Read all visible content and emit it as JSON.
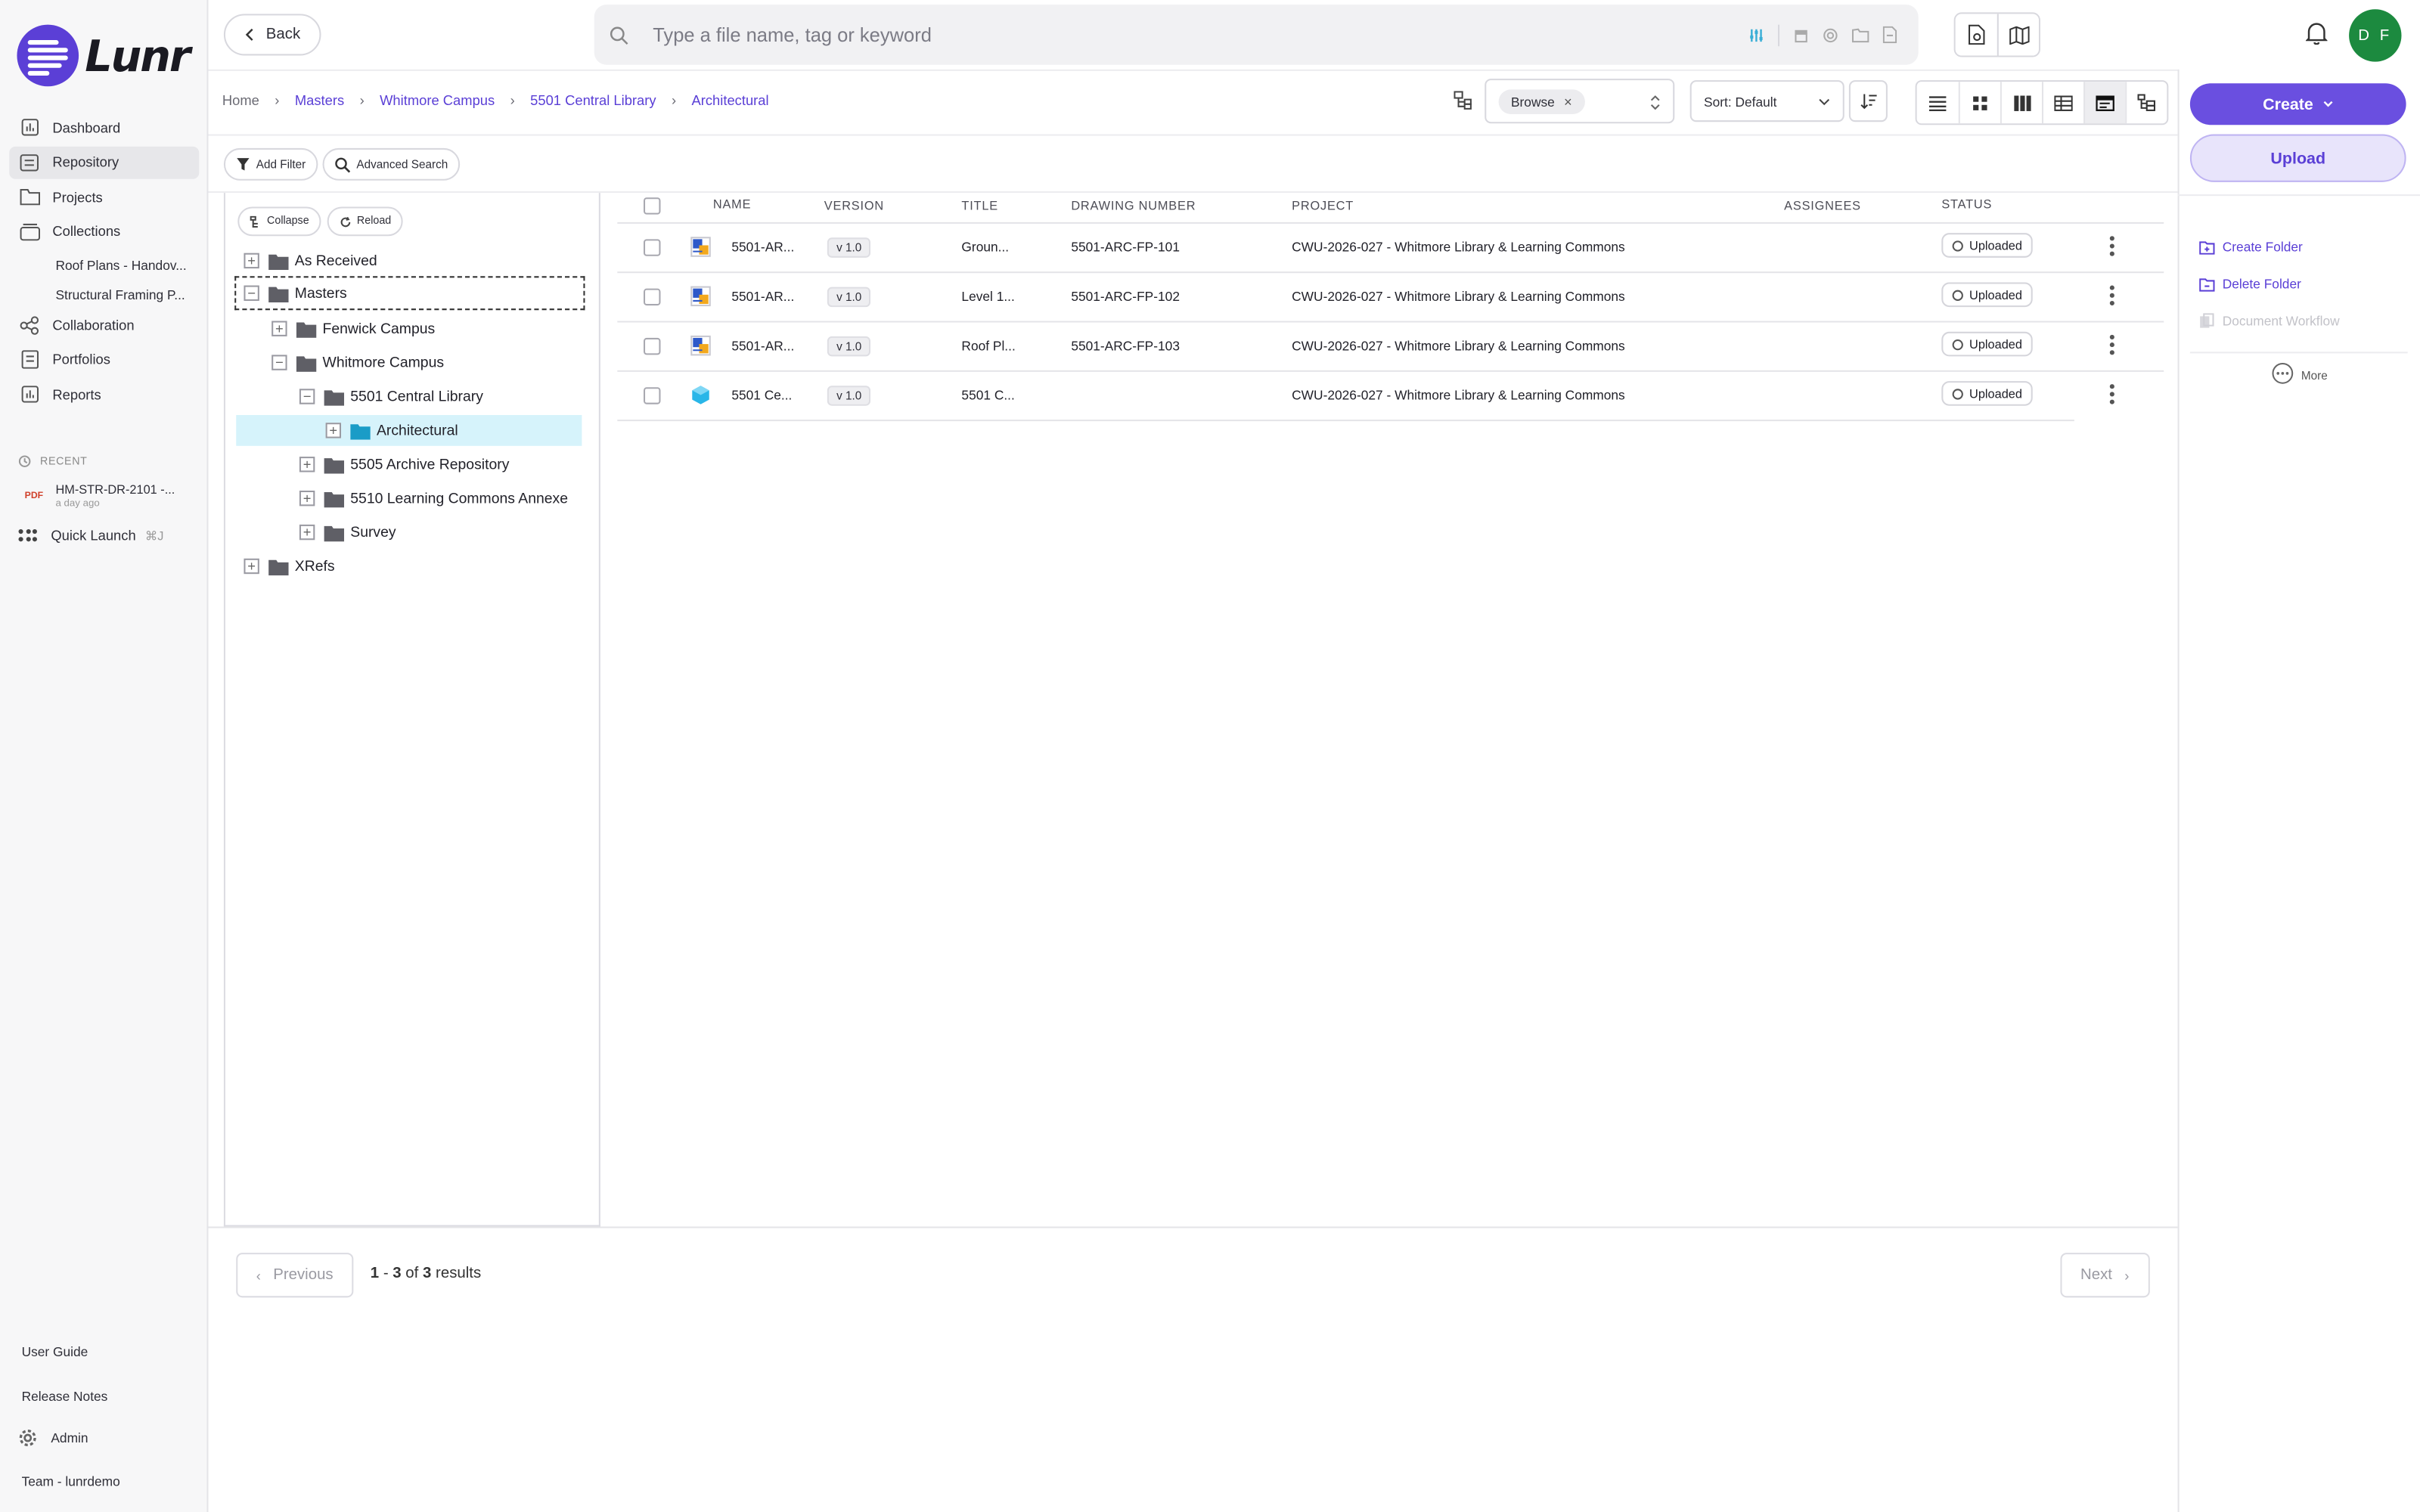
{
  "app": {
    "logo_text": "Lunr"
  },
  "sidebar": {
    "items": [
      {
        "label": "Dashboard",
        "icon": "chart-icon"
      },
      {
        "label": "Repository",
        "icon": "repository-icon",
        "active": true
      },
      {
        "label": "Projects",
        "icon": "folder-icon"
      },
      {
        "label": "Collections",
        "icon": "collection-icon"
      }
    ],
    "collections": [
      "Roof Plans - Handov...",
      "Structural Framing P..."
    ],
    "items2": [
      {
        "label": "Collaboration",
        "icon": "share-icon"
      },
      {
        "label": "Portfolios",
        "icon": "portfolio-icon"
      },
      {
        "label": "Reports",
        "icon": "report-icon"
      }
    ],
    "recent_header": "RECENT",
    "recent": {
      "badge": "PDF",
      "name": "HM-STR-DR-2101 -...",
      "time": "a day ago"
    },
    "quick_launch": {
      "label": "Quick Launch",
      "shortcut": "⌘J"
    },
    "footer": {
      "user_guide": "User Guide",
      "release_notes": "Release Notes",
      "admin": "Admin",
      "team": "Team - lunrdemo"
    }
  },
  "topbar": {
    "back_label": "Back",
    "search_placeholder": "Type a file name, tag or keyword",
    "avatar_initials": "D F"
  },
  "breadcrumb": [
    "Home",
    "Masters",
    "Whitmore Campus",
    "5501 Central Library",
    "Architectural"
  ],
  "toolbar": {
    "browse_chip": "Browse",
    "sort_label": "Sort: Default",
    "add_filter": "Add Filter",
    "advanced_search": "Advanced Search"
  },
  "tree": {
    "collapse_label": "Collapse",
    "reload_label": "Reload",
    "nodes": [
      {
        "label": "As Received",
        "expanded": false
      },
      {
        "label": "Masters",
        "expanded": true
      },
      {
        "label": "Fenwick Campus",
        "expanded": false
      },
      {
        "label": "Whitmore Campus",
        "expanded": true
      },
      {
        "label": "5501 Central Library",
        "expanded": true
      },
      {
        "label": "Architectural",
        "expanded": false,
        "selected": true
      },
      {
        "label": "5505 Archive Repository",
        "expanded": false
      },
      {
        "label": "5510 Learning Commons Annexe",
        "expanded": false
      },
      {
        "label": "Survey",
        "expanded": false
      },
      {
        "label": "XRefs",
        "expanded": false
      }
    ]
  },
  "table": {
    "headers": {
      "name": "NAME",
      "version": "VERSION",
      "title": "TITLE",
      "drawing_number": "DRAWING NUMBER",
      "project": "PROJECT",
      "assignees": "ASSIGNEES",
      "status": "STATUS"
    },
    "rows": [
      {
        "name": "5501-AR...",
        "version": "v 1.0",
        "title": "Groun...",
        "drawing_number": "5501-ARC-FP-101",
        "project": "CWU-2026-027 - Whitmore Library & Learning Commons",
        "status": "Uploaded",
        "icon": "drawing-file-icon"
      },
      {
        "name": "5501-AR...",
        "version": "v 1.0",
        "title": "Level 1...",
        "drawing_number": "5501-ARC-FP-102",
        "project": "CWU-2026-027 - Whitmore Library & Learning Commons",
        "status": "Uploaded",
        "icon": "drawing-file-icon"
      },
      {
        "name": "5501-AR...",
        "version": "v 1.0",
        "title": "Roof Pl...",
        "drawing_number": "5501-ARC-FP-103",
        "project": "CWU-2026-027 - Whitmore Library & Learning Commons",
        "status": "Uploaded",
        "icon": "drawing-file-icon"
      },
      {
        "name": "5501 Ce...",
        "version": "v 1.0",
        "title": "5501 C...",
        "drawing_number": "",
        "project": "CWU-2026-027 - Whitmore Library & Learning Commons",
        "status": "Uploaded",
        "icon": "model-file-icon"
      }
    ]
  },
  "pagination": {
    "previous": "Previous",
    "next": "Next",
    "range_start": "1",
    "range_end": "3",
    "total": "3",
    "dash": " - ",
    "of": " of ",
    "suffix": " results"
  },
  "right_panel": {
    "create_label": "Create",
    "upload_label": "Upload",
    "create_folder": "Create Folder",
    "delete_folder": "Delete Folder",
    "document_workflow": "Document Workflow",
    "more": "More"
  },
  "colors": {
    "accent": "#6a4fe0",
    "avatar": "#1c8a3f",
    "selected_row": "#d6f3fb"
  }
}
